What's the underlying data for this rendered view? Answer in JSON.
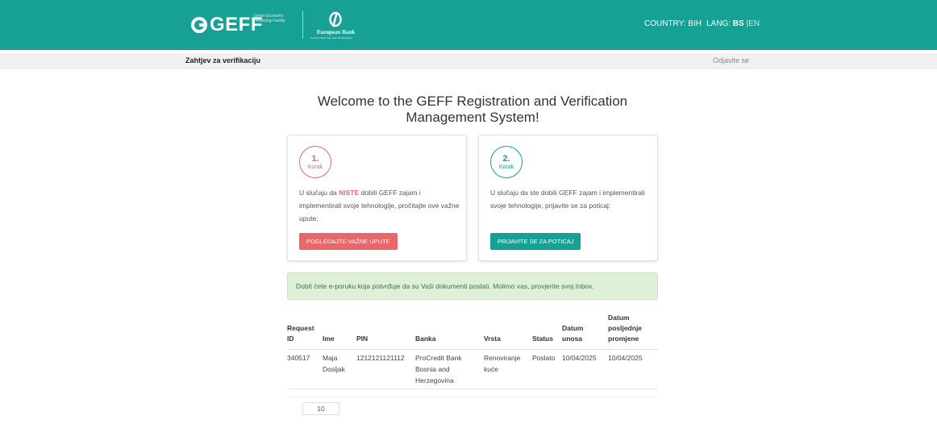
{
  "header": {
    "logo_text": "GEFF",
    "logo_tagline": "Green Economy Financing Facility",
    "partner_name": "European Bank",
    "partner_subtitle": "for Reconstruction and Development",
    "country_label": "COUNTRY: BIH",
    "lang_prefix": "LANG:",
    "lang_active": "BS",
    "lang_separator": "|",
    "lang_other": "EN"
  },
  "subheader": {
    "title": "Zahtjev za verifikaciju",
    "logout": "Odjavite se"
  },
  "welcome": "Welcome to the GEFF Registration and Verification Management System!",
  "steps": [
    {
      "number": "1.",
      "label": "Korak",
      "text_before": "U slučaju da ",
      "text_highlight": "NISTE",
      "text_after": " dobili GEFF zajam i implementirali svoje tehnologije, pročitajte ove važne upute:",
      "button": "POGLEDAJTE VAŽNE UPUTE"
    },
    {
      "number": "2.",
      "label": "Korak",
      "text": "U slučaju da ste dobili GEFF zajam i implementirali svoje tehnologije, prijavite se za poticaj:",
      "button": "PRIJAVITE SE ZA POTICAJ"
    }
  ],
  "alert": "Dobit ćete e-poruku koja potvrđuje da su Vaši dokumenti poslati. Molimo vas, provjerite svoj Inbox.",
  "table": {
    "headers": {
      "request_id": "Request ID",
      "ime": "Ime",
      "pin": "PIN",
      "banka": "Banka",
      "vrsta": "Vrsta",
      "status": "Status",
      "datum_unosa": "Datum unosa",
      "datum_promjene": "Datum posljednje promjene"
    },
    "rows": [
      {
        "request_id": "340517",
        "ime": "Maja Dosljak",
        "pin": "1212121121112",
        "banka": "ProCredit Bank Bosnia and Herzegovina",
        "vrsta": "Renoviranje kuće",
        "status": "Poslato",
        "datum_unosa": "10/04/2025",
        "datum_promjene": "10/04/2025"
      }
    ]
  },
  "pagination": {
    "page_size": "10"
  },
  "colors": {
    "brand_teal": "#17a094",
    "accent_red": "#e8676a",
    "alert_bg": "#dff0d8"
  }
}
